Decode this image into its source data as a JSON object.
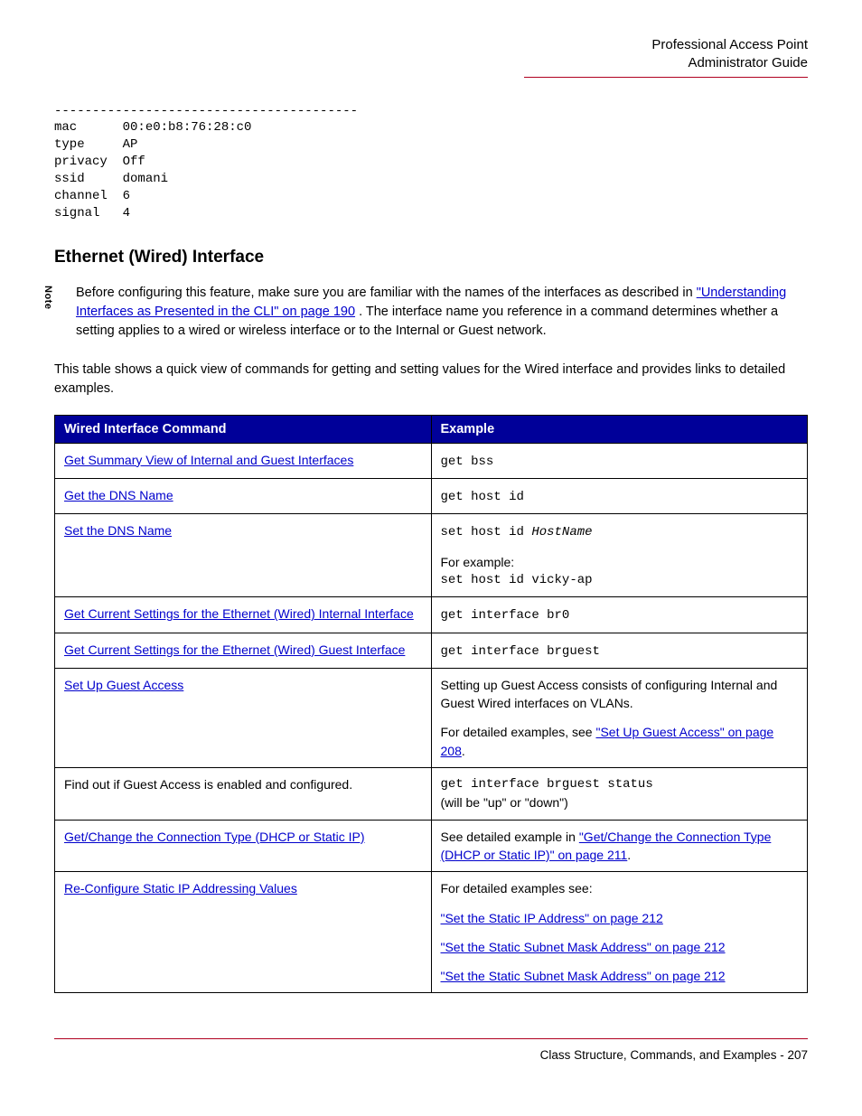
{
  "header": {
    "line1": "Professional Access Point",
    "line2": "Administrator Guide"
  },
  "code_output": "----------------------------------------\nmac      00:e0:b8:76:28:c0\ntype     AP\nprivacy  Off\nssid     domani\nchannel  6\nsignal   4",
  "section_title": "Ethernet (Wired) Interface",
  "note_label": "Note",
  "note": {
    "pre": "Before configuring this feature, make sure you are familiar with the names of the interfaces as described in ",
    "link": "\"Understanding Interfaces as Presented in the CLI\" on page 190",
    "post": ". The interface name you reference in a command determines whether a setting applies to a wired or wireless interface or to the Internal or Guest network."
  },
  "intro": "This table shows a quick view of commands for getting and setting values for the Wired interface and provides links to detailed examples.",
  "table": {
    "headers": {
      "col1": "Wired Interface Command",
      "col2": "Example"
    },
    "rows": [
      {
        "cmd_link": "Get Summary View of Internal and Guest Interfaces",
        "ex_mono": "get bss"
      },
      {
        "cmd_link": "Get the DNS Name",
        "ex_mono": "get host id"
      },
      {
        "cmd_link": "Set the DNS Name",
        "ex_mono_pre": "set host id ",
        "ex_mono_italic": "HostName",
        "ex_extra_label": "For example:",
        "ex_extra_mono": "set host id vicky-ap"
      },
      {
        "cmd_link": "Get Current Settings for the Ethernet (Wired) Internal Interface",
        "ex_mono": "get interface br0"
      },
      {
        "cmd_link": "Get Current Settings for the Ethernet (Wired) Guest Interface",
        "ex_mono": "get interface brguest"
      },
      {
        "cmd_link": "Set Up Guest Access",
        "ex_text": "Setting up Guest Access consists of configuring Internal and Guest Wired interfaces on VLANs.",
        "ex_detail_pre": "For detailed examples, see ",
        "ex_detail_link": "\"Set Up Guest Access\" on page 208",
        "ex_detail_post": "."
      },
      {
        "cmd_text": "Find out if Guest Access is enabled and configured.",
        "ex_mono": "get interface brguest status",
        "ex_sub": "(will be \"up\" or \"down\")"
      },
      {
        "cmd_link": "Get/Change the Connection Type (DHCP or Static IP)",
        "ex_pre": "See detailed example in ",
        "ex_link": "\"Get/Change the Connection Type (DHCP or Static IP)\" on page 211",
        "ex_post": "."
      },
      {
        "cmd_link": "Re-Configure Static IP Addressing Values",
        "ex_intro": "For detailed examples see:",
        "ex_links": [
          "\"Set the Static IP Address\" on page 212",
          "\"Set the Static Subnet Mask Address\" on page 212",
          "\"Set the Static Subnet Mask Address\" on page 212"
        ]
      }
    ]
  },
  "footer": "Class Structure, Commands, and Examples - 207"
}
